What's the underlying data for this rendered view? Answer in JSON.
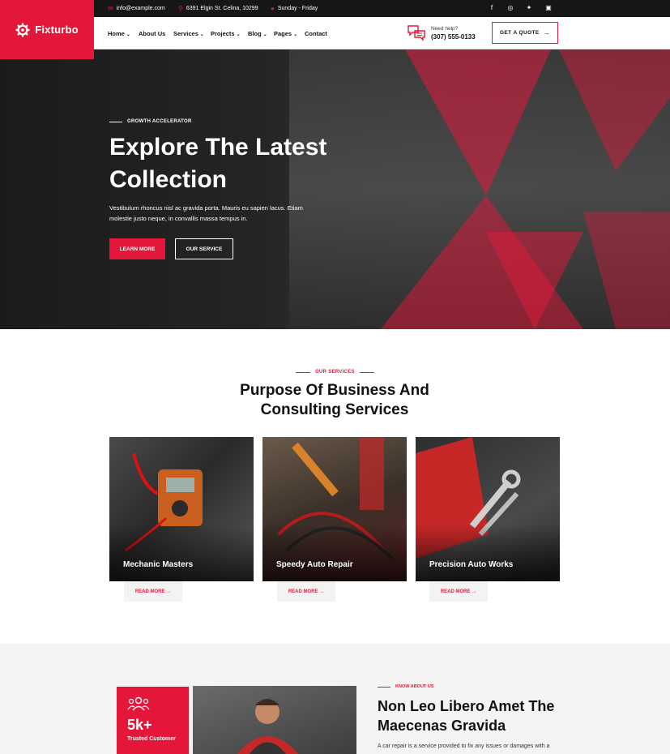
{
  "brand": {
    "name": "Fixturbo",
    "accent": "#e4173a"
  },
  "topbar": {
    "email": "info@example.com",
    "address": "6391 Elgin St. Celina, 10299",
    "hours": "Sunday - Friday",
    "social": [
      "facebook-icon",
      "instagram-icon",
      "twitter-icon",
      "linkedin-icon"
    ]
  },
  "nav": {
    "items": [
      {
        "label": "Home",
        "dropdown": true
      },
      {
        "label": "About Us",
        "dropdown": false
      },
      {
        "label": "Services",
        "dropdown": true
      },
      {
        "label": "Projects",
        "dropdown": true
      },
      {
        "label": "Blog",
        "dropdown": true
      },
      {
        "label": "Pages",
        "dropdown": true
      },
      {
        "label": "Contact",
        "dropdown": false
      }
    ],
    "help_label": "Need help?",
    "help_phone": "(307) 555-0133",
    "quote_label": "GET A QUOTE"
  },
  "hero": {
    "eyebrow": "GROWTH ACCELERATOR",
    "title": "Explore The Latest Collection",
    "lead": "Vestibulum rhoncus nisl ac gravida porta. Mauris eu sapien lacus. Etiam molestie justo neque, in convallis massa tempus in.",
    "primary_button": "LEARN MORE",
    "secondary_button": "OUR SERVICE"
  },
  "services": {
    "eyebrow": "OUR SERVICES",
    "title": "Purpose Of Business And Consulting Services",
    "cards": [
      {
        "title": "Mechanic Masters",
        "read_more": "READ MORE"
      },
      {
        "title": "Speedy Auto Repair",
        "read_more": "READ MORE"
      },
      {
        "title": "Precision Auto Works",
        "read_more": "READ MORE"
      }
    ]
  },
  "about": {
    "stat_value": "5k+",
    "stat_label": "Trusted Customer",
    "eyebrow": "KNOW ABOUT US",
    "title": "Non Leo Libero Amet The Maecenas Gravida",
    "text": "A car repair is a service provided to fix any issues or damages with a"
  }
}
